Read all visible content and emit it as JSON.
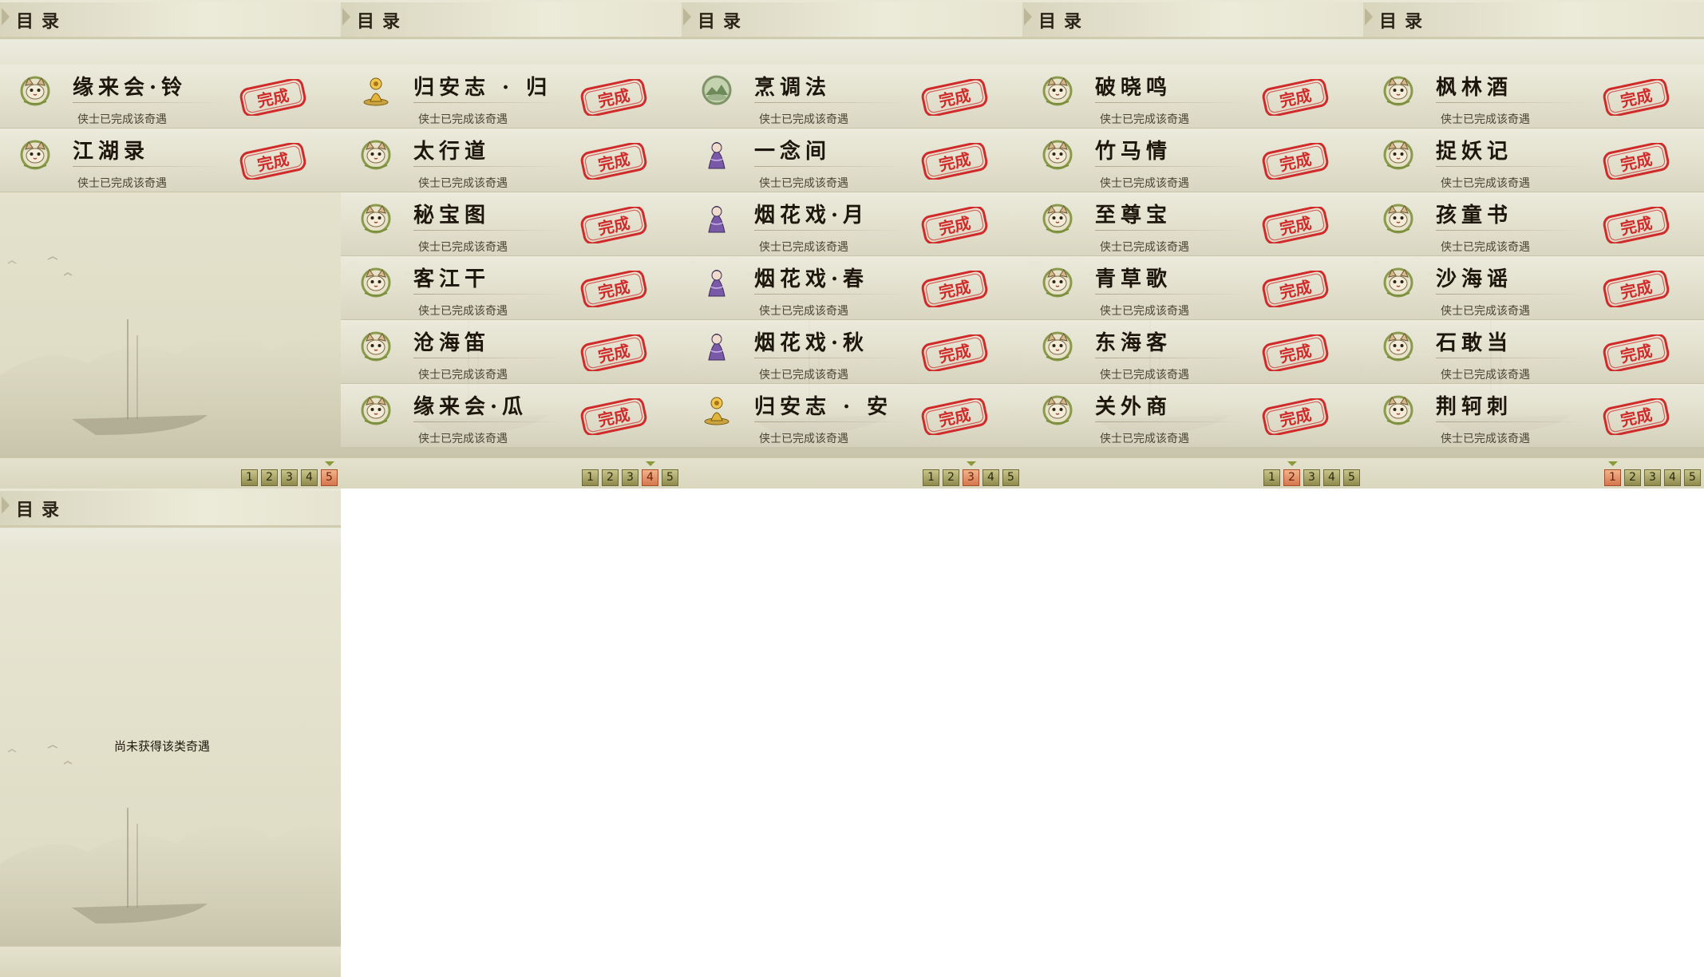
{
  "panels": [
    {
      "title": "目录",
      "current_page": 5,
      "entries": [
        {
          "name": "缘来会·铃",
          "desc": "侠士已完成该奇遇",
          "icon": "cat-face-icon"
        },
        {
          "name": "江湖录",
          "desc": "侠士已完成该奇遇",
          "icon": "cat-face-icon"
        }
      ]
    },
    {
      "title": "目录",
      "current_page": 4,
      "entries": [
        {
          "name": "归安志 · 归",
          "desc": "侠士已完成该奇遇",
          "icon": "golden-figure-icon"
        },
        {
          "name": "太行道",
          "desc": "侠士已完成该奇遇",
          "icon": "cat-face-icon"
        },
        {
          "name": "秘宝图",
          "desc": "侠士已完成该奇遇",
          "icon": "cat-face-icon"
        },
        {
          "name": "客江干",
          "desc": "侠士已完成该奇遇",
          "icon": "cat-face-icon"
        },
        {
          "name": "沧海笛",
          "desc": "侠士已完成该奇遇",
          "icon": "cat-face-icon"
        },
        {
          "name": "缘来会·瓜",
          "desc": "侠士已完成该奇遇",
          "icon": "cat-face-icon"
        }
      ]
    },
    {
      "title": "目录",
      "current_page": 3,
      "entries": [
        {
          "name": "烹调法",
          "desc": "侠士已完成该奇遇",
          "icon": "green-landscape-icon"
        },
        {
          "name": "一念间",
          "desc": "侠士已完成该奇遇",
          "icon": "purple-lady-icon"
        },
        {
          "name": "烟花戏·月",
          "desc": "侠士已完成该奇遇",
          "icon": "purple-lady-icon"
        },
        {
          "name": "烟花戏·春",
          "desc": "侠士已完成该奇遇",
          "icon": "purple-lady-icon"
        },
        {
          "name": "烟花戏·秋",
          "desc": "侠士已完成该奇遇",
          "icon": "purple-lady-icon"
        },
        {
          "name": "归安志 · 安",
          "desc": "侠士已完成该奇遇",
          "icon": "golden-figure-icon"
        }
      ]
    },
    {
      "title": "目录",
      "current_page": 2,
      "entries": [
        {
          "name": "破晓鸣",
          "desc": "侠士已完成该奇遇",
          "icon": "cat-face-icon"
        },
        {
          "name": "竹马情",
          "desc": "侠士已完成该奇遇",
          "icon": "cat-face-icon"
        },
        {
          "name": "至尊宝",
          "desc": "侠士已完成该奇遇",
          "icon": "cat-face-icon"
        },
        {
          "name": "青草歌",
          "desc": "侠士已完成该奇遇",
          "icon": "cat-face-icon"
        },
        {
          "name": "东海客",
          "desc": "侠士已完成该奇遇",
          "icon": "cat-face-icon"
        },
        {
          "name": "关外商",
          "desc": "侠士已完成该奇遇",
          "icon": "cat-face-icon"
        }
      ]
    },
    {
      "title": "目录",
      "current_page": 1,
      "entries": [
        {
          "name": "枫林酒",
          "desc": "侠士已完成该奇遇",
          "icon": "cat-face-icon"
        },
        {
          "name": "捉妖记",
          "desc": "侠士已完成该奇遇",
          "icon": "cat-face-icon"
        },
        {
          "name": "孩童书",
          "desc": "侠士已完成该奇遇",
          "icon": "cat-face-icon"
        },
        {
          "name": "沙海谣",
          "desc": "侠士已完成该奇遇",
          "icon": "cat-face-icon"
        },
        {
          "name": "石敢当",
          "desc": "侠士已完成该奇遇",
          "icon": "cat-face-icon"
        },
        {
          "name": "荆轲刺",
          "desc": "侠士已完成该奇遇",
          "icon": "cat-face-icon"
        }
      ]
    },
    {
      "title": "目录",
      "empty_message": "尚未获得该类奇遇",
      "entries": []
    }
  ],
  "pages": [
    "1",
    "2",
    "3",
    "4",
    "5"
  ],
  "stamp_text": "完成",
  "colors": {
    "stamp_red": "#d12a2a",
    "active_page": "#d5764d",
    "page_button": "#8f8a4c",
    "parchment": "#e3e1cb"
  }
}
